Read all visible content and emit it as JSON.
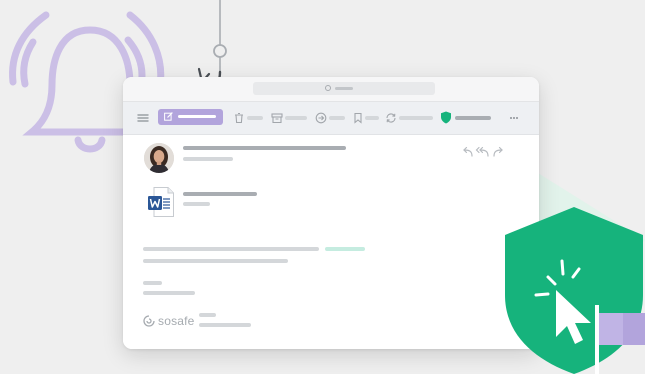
{
  "brand": {
    "logo_text": "sosafe"
  },
  "icons": {
    "bell": "bell-icon",
    "hook": "phishing-hook-icon",
    "menu": "hamburger-icon",
    "compose": "compose-icon",
    "delete": "trash-icon",
    "archive": "archive-icon",
    "move": "move-icon",
    "bookmark": "bookmark-icon",
    "sync": "sync-icon",
    "report": "shield-icon",
    "more": "more-icon",
    "reply": "reply-icon",
    "reply_all": "reply-all-icon",
    "forward": "forward-icon",
    "attachment": "word-document-icon",
    "click": "cursor-click-icon",
    "flag": "flag-icon"
  },
  "colors": {
    "accent_purple": "#b2a4dc",
    "shield_green": "#16b37c",
    "word_blue": "#2b5797",
    "beam": "#dff3ea"
  }
}
